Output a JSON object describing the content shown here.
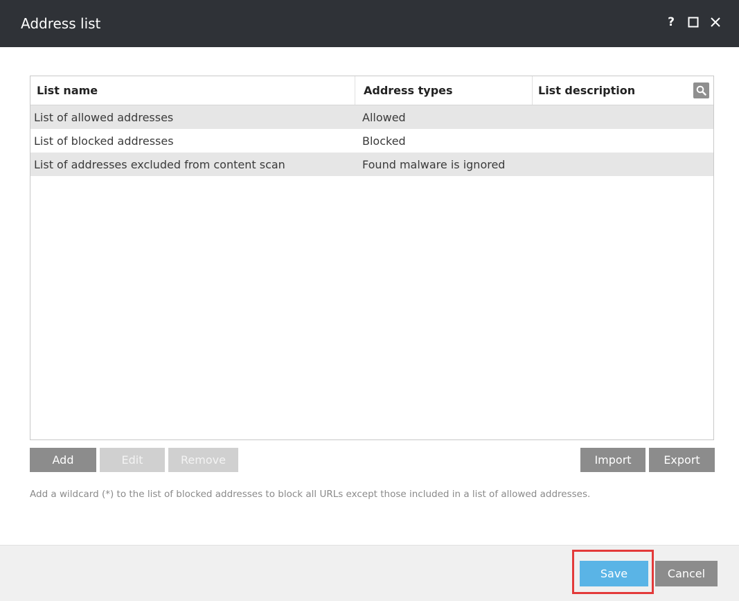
{
  "window": {
    "title": "Address list",
    "help_label": "?"
  },
  "table": {
    "columns": [
      "List name",
      "Address types",
      "List description"
    ],
    "rows": [
      {
        "name": "List of allowed addresses",
        "type": "Allowed",
        "description": ""
      },
      {
        "name": "List of blocked addresses",
        "type": "Blocked",
        "description": ""
      },
      {
        "name": "List of addresses excluded from content scan",
        "type": "Found malware is ignored",
        "description": ""
      }
    ]
  },
  "buttons": {
    "add": "Add",
    "edit": "Edit",
    "remove": "Remove",
    "import": "Import",
    "export": "Export"
  },
  "hint": "Add a wildcard (*) to the list of blocked addresses to block all URLs except those included in a list of allowed addresses.",
  "footer": {
    "save": "Save",
    "cancel": "Cancel"
  },
  "icons": {
    "search": "search-icon",
    "help": "help-icon",
    "maximize": "maximize-icon",
    "close": "close-icon"
  },
  "colors": {
    "titlebar": "#2f3237",
    "primary_button": "#5ab4e6",
    "secondary_button": "#8c8c8c",
    "highlight": "#e33a3a"
  }
}
